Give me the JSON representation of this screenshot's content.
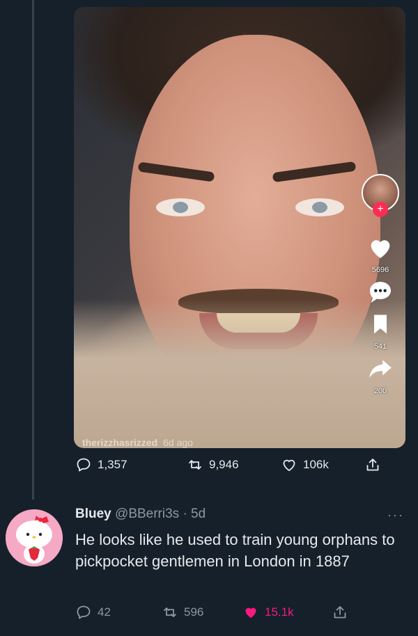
{
  "embedded_video": {
    "watermark_user": "therizzhasrizzed",
    "watermark_age": "6d ago",
    "likes": "5696",
    "saves": "541",
    "shares": "200",
    "follow_symbol": "+"
  },
  "tweet_actions": {
    "replies": "1,357",
    "retweets": "9,946",
    "likes": "106k"
  },
  "reply": {
    "display_name": "Bluey",
    "handle_time": "@BBerri3s · 5d",
    "more_label": "···",
    "text": "He looks like he used to train young orphans to pickpocket gentlemen in London in 1887",
    "replies": "42",
    "retweets": "596",
    "likes": "15.1k",
    "liked_color": "#f91880"
  },
  "colors": {
    "background": "#15202b",
    "text": "#e7e9ea",
    "muted": "#8b98a5",
    "tiktok_red": "#fe2c55"
  },
  "icons": [
    "comment-icon",
    "retweet-icon",
    "heart-icon",
    "share-icon",
    "tiktok-heart-icon",
    "tiktok-comment-icon",
    "tiktok-bookmark-icon",
    "tiktok-share-icon"
  ]
}
